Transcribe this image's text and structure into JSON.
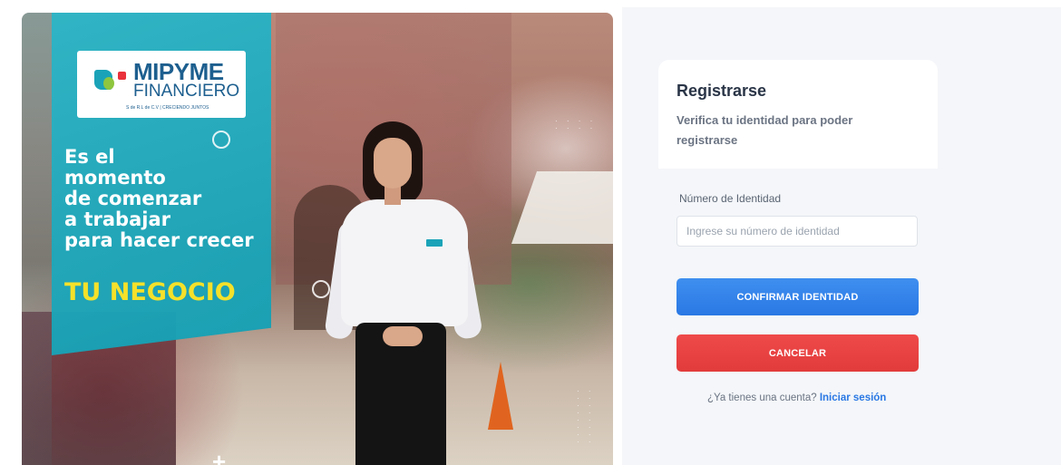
{
  "hero": {
    "logo": {
      "title": "MIPYME",
      "subtitle": "FINANCIERO",
      "tagline": "S de R.L de C.V  |  CRECIENDO JUNTOS"
    },
    "headline_lines": [
      "Es el",
      "momento",
      "de comenzar",
      "a trabajar",
      "para hacer crecer"
    ],
    "highlight": "TU NEGOCIO",
    "colors": {
      "banner": "#1fb0c3",
      "highlight": "#f5e12a"
    }
  },
  "form": {
    "title": "Registrarse",
    "subtitle": "Verifica tu identidad para poder registrarse",
    "id_label": "Número de Identidad",
    "id_placeholder": "Ingrese su número de identidad",
    "id_value": "",
    "confirm_label": "CONFIRMAR IDENTIDAD",
    "cancel_label": "CANCELAR",
    "footer_prompt": "¿Ya tienes una cuenta?",
    "footer_link": "Iniciar sesión",
    "colors": {
      "confirm": "#2f80ed",
      "cancel": "#e84142",
      "link": "#2a78e4"
    }
  }
}
